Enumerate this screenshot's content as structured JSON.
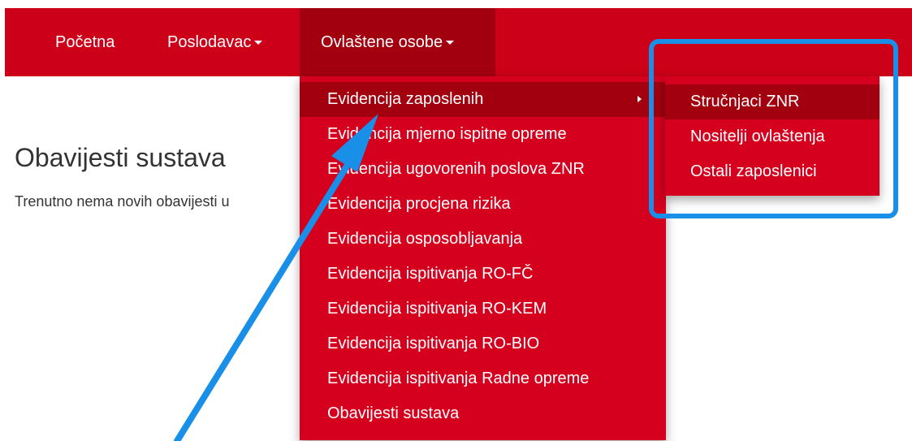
{
  "navbar": {
    "items": [
      {
        "label": "Početna",
        "has_caret": false
      },
      {
        "label": "Poslodavac",
        "has_caret": true
      },
      {
        "label": "Ovlaštene osobe",
        "has_caret": true,
        "active": true
      }
    ]
  },
  "page": {
    "title": "Obavijesti sustava",
    "text": "Trenutno nema novih obavijesti u"
  },
  "dropdown": {
    "items": [
      {
        "label": "Evidencija zaposlenih",
        "active": true,
        "has_submenu": true
      },
      {
        "label": "Evidencija mjerno ispitne opreme"
      },
      {
        "label": "Evidencija ugovorenih poslova ZNR"
      },
      {
        "label": "Evidencija procjena rizika"
      },
      {
        "label": "Evidencija osposobljavanja"
      },
      {
        "label": "Evidencija ispitivanja RO-FČ"
      },
      {
        "label": "Evidencija ispitivanja RO-KEM"
      },
      {
        "label": "Evidencija ispitivanja RO-BIO"
      },
      {
        "label": "Evidencija ispitivanja Radne opreme"
      },
      {
        "label": "Obavijesti sustava"
      }
    ]
  },
  "submenu": {
    "items": [
      {
        "label": "Stručnjaci ZNR",
        "active": true
      },
      {
        "label": "Nositelji ovlaštenja"
      },
      {
        "label": "Ostali zaposlenici"
      }
    ]
  },
  "colors": {
    "navbar_bg": "#cc0018",
    "menu_bg": "#d4001e",
    "active_bg": "#a2000f",
    "annotation_blue": "#1a8fe8"
  }
}
